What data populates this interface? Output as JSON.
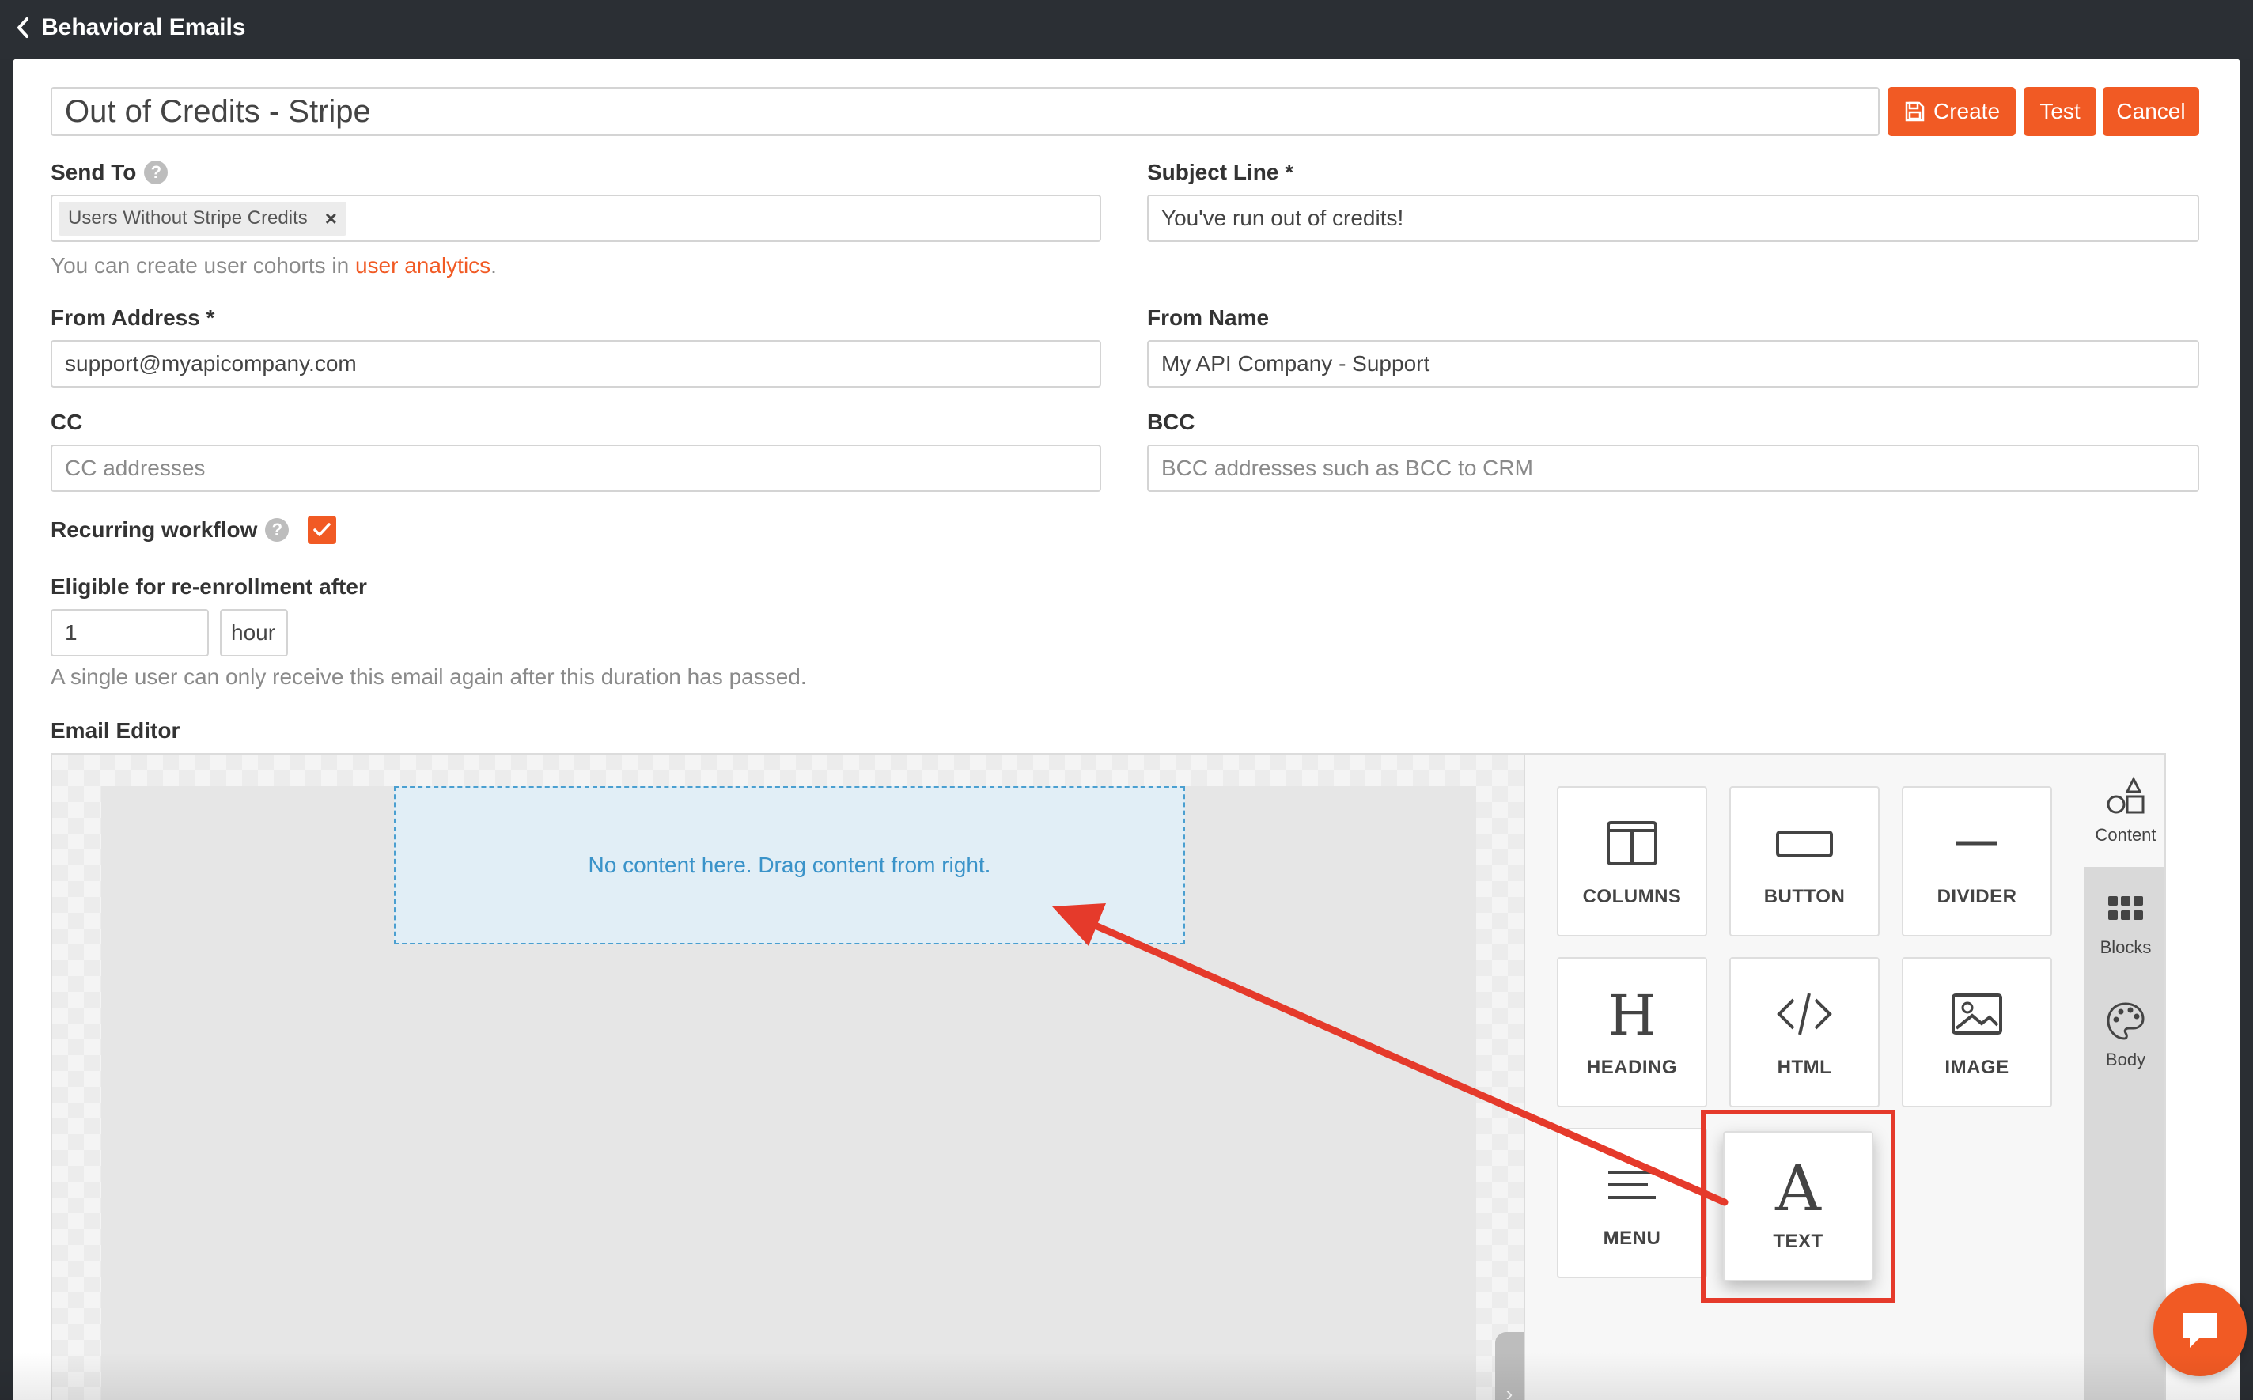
{
  "header": {
    "back_label": "Behavioral Emails"
  },
  "title": "Out of Credits - Stripe",
  "buttons": {
    "create": "Create",
    "test": "Test",
    "cancel": "Cancel"
  },
  "send_to": {
    "label": "Send To",
    "tag": "Users Without Stripe Credits",
    "hint_prefix": "You can create user cohorts in ",
    "hint_link": "user analytics",
    "hint_suffix": "."
  },
  "subject": {
    "label": "Subject Line *",
    "value": "You've run out of credits!"
  },
  "from_address": {
    "label": "From Address *",
    "value": "support@myapicompany.com"
  },
  "from_name": {
    "label": "From Name",
    "value": "My API Company - Support"
  },
  "cc": {
    "label": "CC",
    "placeholder": "CC addresses"
  },
  "bcc": {
    "label": "BCC",
    "placeholder": "BCC addresses such as BCC to CRM"
  },
  "recurring": {
    "label": "Recurring workflow",
    "checked": true
  },
  "reenroll": {
    "label": "Eligible for re-enrollment after",
    "value": "1",
    "unit": "hour",
    "hint": "A single user can only receive this email again after this duration has passed."
  },
  "editor": {
    "label": "Email Editor",
    "dropzone": "No content here. Drag content from right.",
    "tools": [
      "COLUMNS",
      "BUTTON",
      "DIVIDER",
      "HEADING",
      "HTML",
      "IMAGE",
      "MENU",
      "TEXT"
    ],
    "tabs": [
      "Content",
      "Blocks",
      "Body"
    ]
  },
  "colors": {
    "accent": "#f15a24",
    "annotation": "#e53a2b",
    "topbar": "#2b2f34"
  }
}
